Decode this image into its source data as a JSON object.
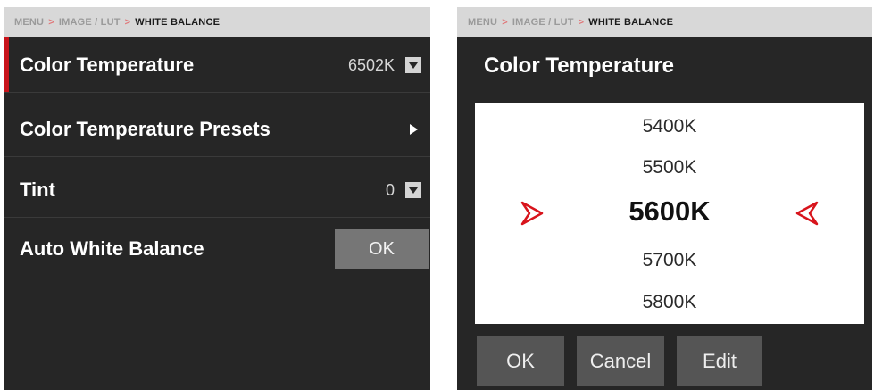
{
  "left_panel": {
    "breadcrumb": {
      "root": "MENU",
      "middle": "IMAGE / LUT",
      "current": "WHITE BALANCE",
      "separator": ">"
    },
    "items": [
      {
        "label": "Color Temperature",
        "value": "6502K",
        "control": "dropdown"
      },
      {
        "label": "Color Temperature Presets",
        "value": "",
        "control": "submenu"
      },
      {
        "label": "Tint",
        "value": "0",
        "control": "dropdown"
      },
      {
        "label": "Auto White Balance",
        "value": "",
        "control": "button"
      }
    ],
    "ok_button": "OK"
  },
  "right_panel": {
    "breadcrumb": {
      "root": "MENU",
      "middle": "IMAGE / LUT",
      "current": "WHITE BALANCE",
      "separator": ">"
    },
    "title": "Color Temperature",
    "picker_values": [
      "5400K",
      "5500K",
      "5600K",
      "5700K",
      "5800K"
    ],
    "selected_value": "5600K",
    "buttons": {
      "ok": "OK",
      "cancel": "Cancel",
      "edit": "Edit"
    }
  },
  "colors": {
    "panel_bg": "#262626",
    "accent_red": "#c8141b",
    "breadcrumb_bg": "#d8d8d8",
    "button_gray": "#767676"
  },
  "icons": {
    "dropdown": "chevron-down-icon",
    "submenu": "chevron-right-icon",
    "picker_left": "triangle-right-icon",
    "picker_right": "triangle-left-icon"
  }
}
